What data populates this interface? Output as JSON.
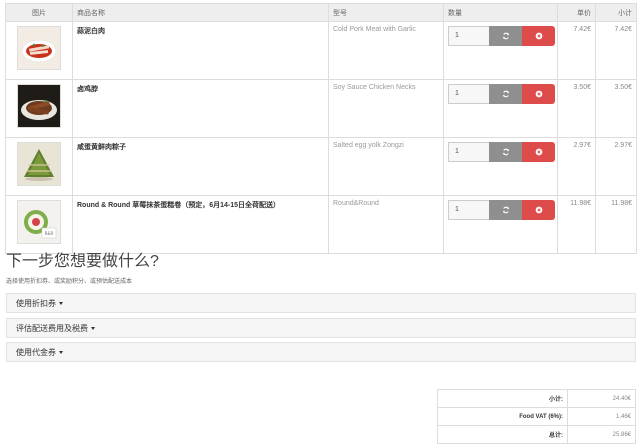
{
  "cart": {
    "headers": {
      "image": "图片",
      "name": "商品名称",
      "model": "型号",
      "quantity": "数量",
      "unit_price": "单价",
      "total": "小计"
    },
    "items": [
      {
        "name": "蒜泥白肉",
        "model": "Cold Pork Meat with Garlic",
        "quantity": "1",
        "unit_price": "7.42€",
        "total": "7.42€",
        "image": "garlic-pork-photo"
      },
      {
        "name": "卤鸡脖",
        "model": "Soy Sauce Chicken Necks",
        "quantity": "1",
        "unit_price": "3.50€",
        "total": "3.50€",
        "image": "chicken-necks-photo"
      },
      {
        "name": "咸蛋黄鲜肉粽子",
        "model": "Salted egg yolk Zongzi",
        "quantity": "1",
        "unit_price": "2.97€",
        "total": "2.97€",
        "image": "zongzi-photo"
      },
      {
        "name": "Round & Round 草莓抹茶蛋糕卷（预定，6月14-15日全荷配送）",
        "model": "Round&Round",
        "quantity": "1",
        "unit_price": "11.98€",
        "total": "11.98€",
        "image": "matcha-roll-photo"
      }
    ],
    "icons": {
      "refresh": "refresh-icon",
      "remove": "close-circle-icon"
    },
    "colors": {
      "refresh": "#8f8f8f",
      "remove": "#dd4b4b"
    }
  },
  "next_step": {
    "title": "下一步您想要做什么?",
    "subtitle": "选择使用折扣券、或奖励积分、或预估配送成本",
    "panels": [
      "使用折扣券",
      "评估配送费用及税费",
      "使用代金券"
    ]
  },
  "totals": [
    {
      "label": "小计:",
      "value": "24.40€"
    },
    {
      "label": "Food VAT (6%):",
      "value": "1.46€"
    },
    {
      "label": "总计:",
      "value": "25.86€"
    }
  ]
}
